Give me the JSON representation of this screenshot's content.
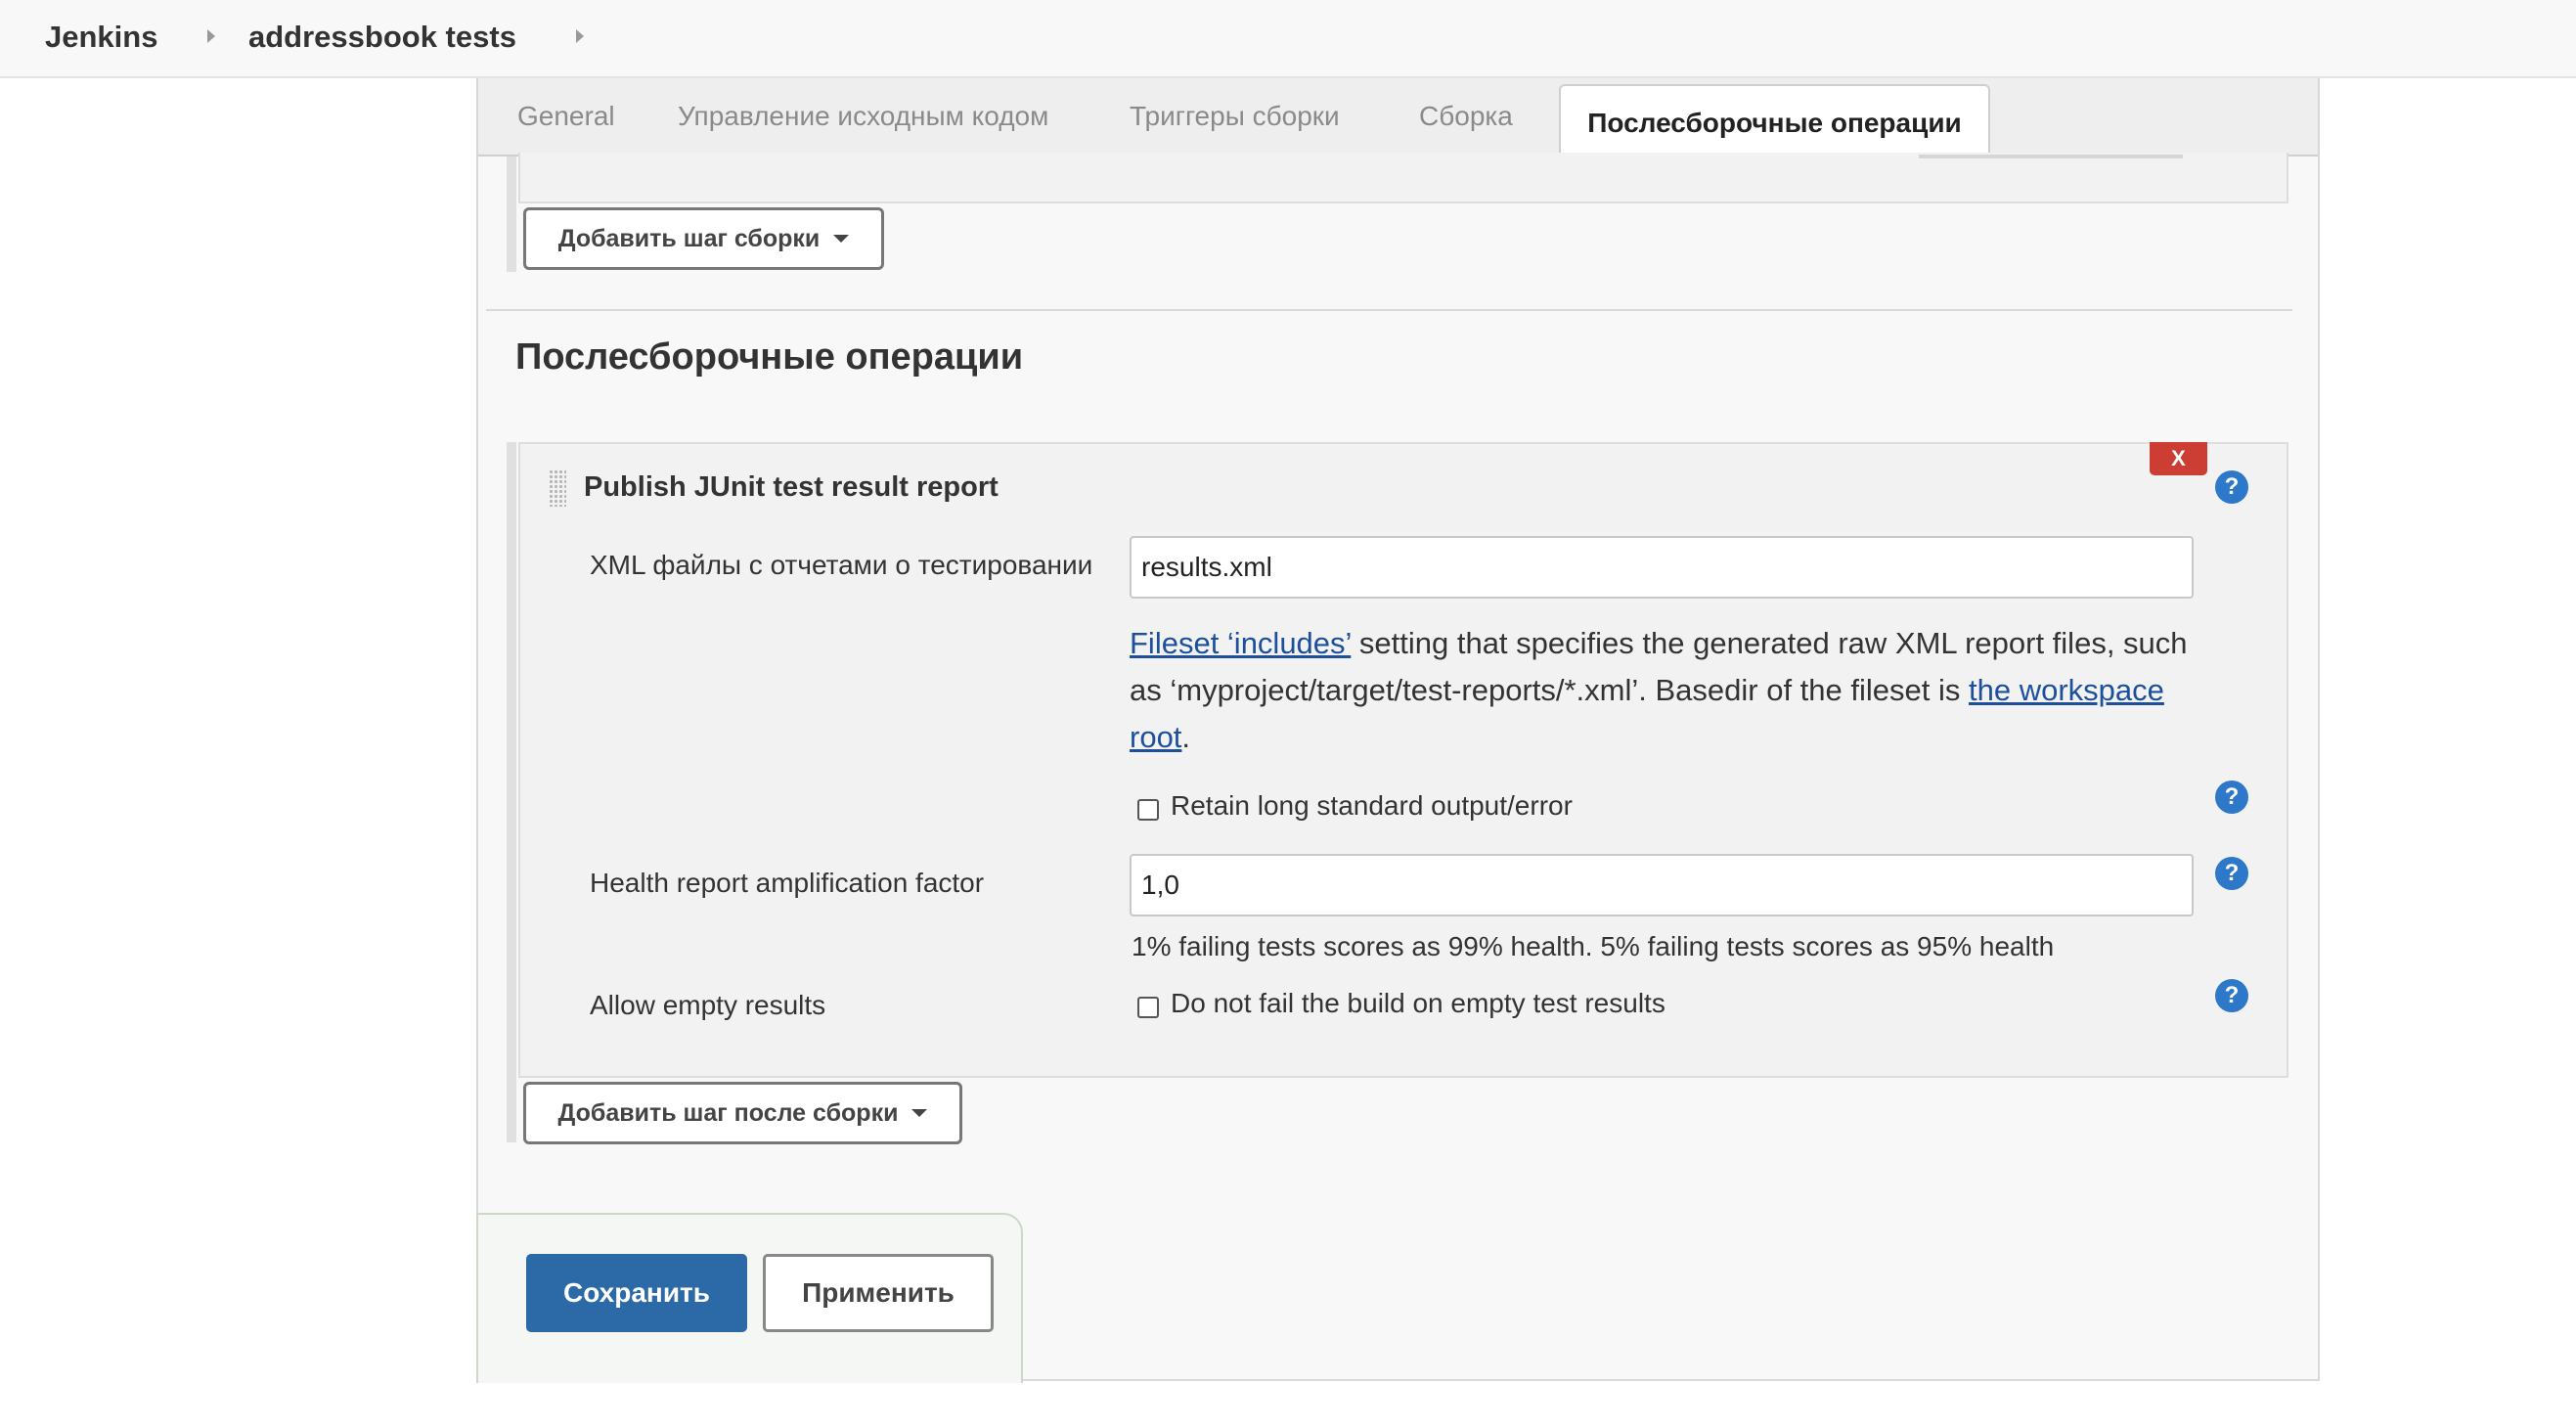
{
  "breadcrumb": {
    "items": [
      "Jenkins",
      "addressbook tests"
    ]
  },
  "tabs": {
    "items": [
      "General",
      "Управление исходным кодом",
      "Триггеры сборки",
      "Сборка"
    ],
    "active": "Послесборочные операции"
  },
  "build": {
    "add_step_label": "Добавить шаг сборки"
  },
  "post_build": {
    "section_title": "Послесборочные операции",
    "step": {
      "title": "Publish JUnit test result report",
      "delete_label": "X",
      "xml_label": "XML файлы с отчетами о тестировании",
      "xml_value": "results.xml",
      "help_text": {
        "link1": "Fileset ‘includes’",
        "text1": " setting that specifies the generated raw XML report files, such as ‘myproject/target/test-reports/*.xml’. Basedir of the fileset is ",
        "link2": "the workspace root",
        "text2": "."
      },
      "retain_label": "Retain long standard output/error",
      "retain_checked": false,
      "health_label": "Health report amplification factor",
      "health_value": "1,0",
      "health_note": "1% failing tests scores as 99% health. 5% failing tests scores as 95% health",
      "allow_empty_label": "Allow empty results",
      "allow_empty_checkbox_label": "Do not fail the build on empty test results",
      "allow_empty_checked": false
    },
    "add_step_label": "Добавить шаг после сборки"
  },
  "actions": {
    "save_label": "Сохранить",
    "apply_label": "Применить"
  },
  "help_icon_glyph": "?",
  "colors": {
    "primary_button": "#2b6aa7",
    "delete_button": "#cc3e33",
    "help_icon": "#2d78c8",
    "link": "#1c4f9c"
  }
}
